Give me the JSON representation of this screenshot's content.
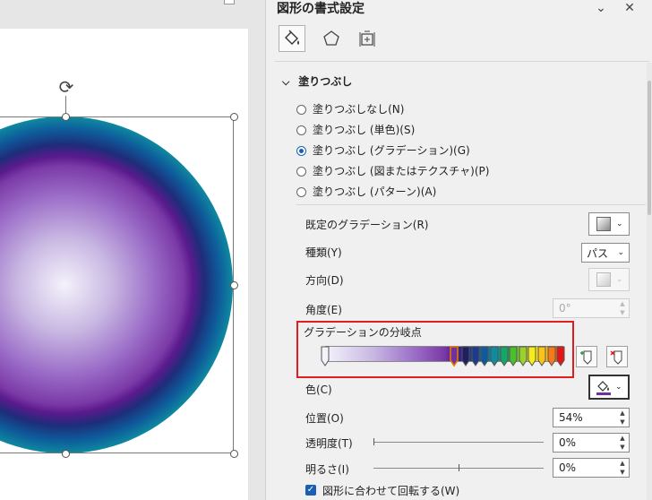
{
  "pane": {
    "title": "図形の書式設定",
    "dropdown_icon": "chevron-down-icon",
    "close_icon": "close-icon",
    "tabs": [
      {
        "name": "fill-line-tab",
        "icon": "paint-bucket-icon",
        "active": true
      },
      {
        "name": "effects-tab",
        "icon": "pentagon-icon",
        "active": false
      },
      {
        "name": "size-properties-tab",
        "icon": "size-properties-icon",
        "active": false
      }
    ]
  },
  "fill": {
    "section_label": "塗りつぶし",
    "options": [
      {
        "label": "塗りつぶしなし(N)",
        "checked": false
      },
      {
        "label": "塗りつぶし (単色)(S)",
        "checked": false
      },
      {
        "label": "塗りつぶし (グラデーション)(G)",
        "checked": true
      },
      {
        "label": "塗りつぶし (図またはテクスチャ)(P)",
        "checked": false
      },
      {
        "label": "塗りつぶし (パターン)(A)",
        "checked": false
      }
    ],
    "preset_label": "既定のグラデーション(R)",
    "type_label": "種類(Y)",
    "type_value": "パス",
    "direction_label": "方向(D)",
    "angle_label": "角度(E)",
    "angle_value": "0°",
    "stops_label": "グラデーションの分岐点",
    "color_label": "色(C)",
    "position_label": "位置(O)",
    "position_value": "54%",
    "transparency_label": "透明度(T)",
    "transparency_value": "0%",
    "transparency_level": 0,
    "brightness_label": "明るさ(I)",
    "brightness_value": "0%",
    "brightness_level": 0.5,
    "rotate_label": "図形に合わせて回転する(W)",
    "rotate_checked": true
  },
  "colors": {
    "accent": "#1a5fb4",
    "highlight_box": "#e01e1e",
    "selected_stop": "#7030a0"
  },
  "gradient_stops": [
    {
      "color": "#f4f2fb",
      "position": 0
    },
    {
      "color": "#7030a0",
      "position": 54,
      "selected": true
    },
    {
      "color": "#1f1f5f",
      "position": 59
    },
    {
      "color": "#1e3a8a",
      "position": 63
    },
    {
      "color": "#0e5a9a",
      "position": 67
    },
    {
      "color": "#0f8ba0",
      "position": 71
    },
    {
      "color": "#16a66a",
      "position": 75
    },
    {
      "color": "#4cbf2a",
      "position": 79
    },
    {
      "color": "#9bd12c",
      "position": 83
    },
    {
      "color": "#f6ec1b",
      "position": 87
    },
    {
      "color": "#fbc21a",
      "position": 91
    },
    {
      "color": "#f77a17",
      "position": 95
    },
    {
      "color": "#e61414",
      "position": 99
    }
  ]
}
